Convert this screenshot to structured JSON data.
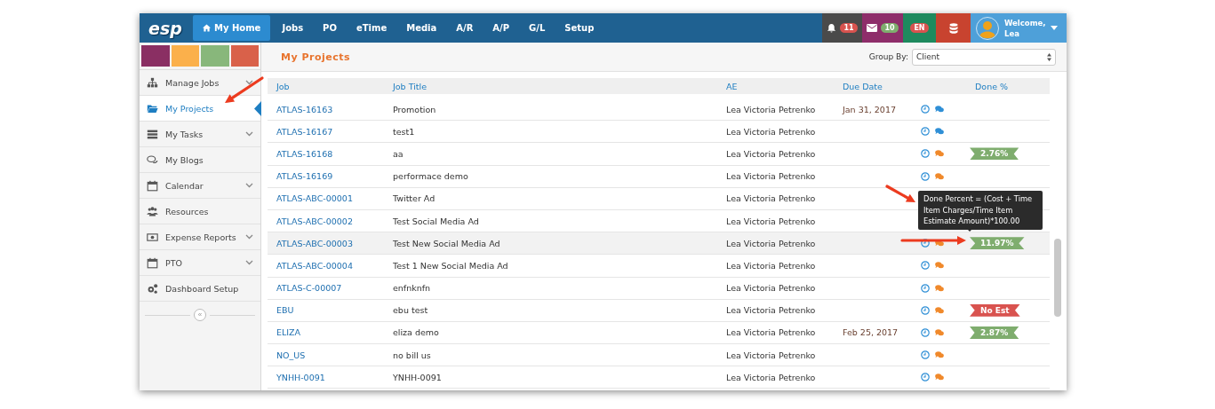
{
  "nav": {
    "logo": "esp",
    "items": [
      {
        "label": "My Home",
        "selected": true
      },
      {
        "label": "Jobs",
        "selected": false
      },
      {
        "label": "PO",
        "selected": false
      },
      {
        "label": "eTime",
        "selected": false
      },
      {
        "label": "Media",
        "selected": false
      },
      {
        "label": "A/R",
        "selected": false
      },
      {
        "label": "A/P",
        "selected": false
      },
      {
        "label": "G/L",
        "selected": false
      },
      {
        "label": "Setup",
        "selected": false
      }
    ],
    "notifications": "11",
    "messages": "10",
    "language": "EN",
    "welcome": "Welcome,",
    "user": "Lea"
  },
  "sidebar": {
    "swatches": [
      {
        "color": "#8a2f63"
      },
      {
        "color": "#fbb04b"
      },
      {
        "color": "#88b77b"
      },
      {
        "color": "#d9614a"
      }
    ],
    "items": [
      {
        "kind": "sitemap",
        "label": "Manage Jobs",
        "expandable": true,
        "selected": false
      },
      {
        "kind": "folder",
        "label": "My Projects",
        "expandable": false,
        "selected": true
      },
      {
        "kind": "tasks",
        "label": "My Tasks",
        "expandable": true,
        "selected": false
      },
      {
        "kind": "chat",
        "label": "My Blogs",
        "expandable": false,
        "selected": false
      },
      {
        "kind": "calendar",
        "label": "Calendar",
        "expandable": true,
        "selected": false
      },
      {
        "kind": "people",
        "label": "Resources",
        "expandable": false,
        "selected": false
      },
      {
        "kind": "money",
        "label": "Expense Reports",
        "expandable": true,
        "selected": false
      },
      {
        "kind": "calendar",
        "label": "PTO",
        "expandable": true,
        "selected": false
      },
      {
        "kind": "gears",
        "label": "Dashboard Setup",
        "expandable": false,
        "selected": false
      }
    ],
    "collapse": "«"
  },
  "page": {
    "title": "My Projects",
    "group_by_label": "Group By:",
    "group_by_value": "Client"
  },
  "table": {
    "columns": [
      "Job",
      "Job Title",
      "AE",
      "Due Date",
      "Done %"
    ],
    "rows": [
      {
        "job": "ATLAS-16163",
        "title": "Promotion",
        "ae": "Lea Victoria Petrenko",
        "due": "Jan 31, 2017",
        "chat": {
          "color": "#2f8fd6"
        },
        "highlighted": false
      },
      {
        "job": "ATLAS-16167",
        "title": "test1",
        "ae": "Lea Victoria Petrenko",
        "chat": {
          "color": "#2f8fd6"
        },
        "highlighted": false
      },
      {
        "job": "ATLAS-16168",
        "title": "aa",
        "ae": "Lea Victoria Petrenko",
        "chat": {
          "color": "#f0892b"
        },
        "highlighted": false,
        "done": {
          "text": "2.76%",
          "color": "#7fad6e"
        }
      },
      {
        "job": "ATLAS-16169",
        "title": "performace demo",
        "ae": "Lea Victoria Petrenko",
        "chat": {
          "color": "#f0892b"
        },
        "highlighted": false
      },
      {
        "job": "ATLAS-ABC-00001",
        "title": "Twitter Ad",
        "ae": "Lea Victoria Petrenko",
        "highlighted": false
      },
      {
        "job": "ATLAS-ABC-00002",
        "title": "Test Social Media Ad",
        "ae": "Lea Victoria Petrenko",
        "highlighted": false
      },
      {
        "job": "ATLAS-ABC-00003",
        "title": "Test New Social Media Ad",
        "ae": "Lea Victoria Petrenko",
        "chat": {
          "color": "#f0892b"
        },
        "highlighted": true,
        "done": {
          "text": "11.97%",
          "color": "#7fad6e"
        }
      },
      {
        "job": "ATLAS-ABC-00004",
        "title": "Test 1 New Social Media Ad",
        "ae": "Lea Victoria Petrenko",
        "chat": {
          "color": "#f0892b"
        },
        "highlighted": false
      },
      {
        "job": "ATLAS-C-00007",
        "title": "enfnknfn",
        "ae": "Lea Victoria Petrenko",
        "chat": {
          "color": "#f0892b"
        },
        "highlighted": false
      },
      {
        "job": "EBU",
        "title": "ebu test",
        "ae": "Lea Victoria Petrenko",
        "chat": {
          "color": "#f0892b"
        },
        "highlighted": false,
        "done": {
          "text": "No Est",
          "color": "#d9534f"
        }
      },
      {
        "job": "ELIZA",
        "title": "eliza demo",
        "ae": "Lea Victoria Petrenko",
        "due": "Feb 25, 2017",
        "chat": {
          "color": "#f0892b"
        },
        "highlighted": false,
        "done": {
          "text": "2.87%",
          "color": "#7fad6e"
        }
      },
      {
        "job": "NO_US",
        "title": "no bill us",
        "ae": "Lea Victoria Petrenko",
        "chat": {
          "color": "#f0892b"
        },
        "highlighted": false
      },
      {
        "job": "YNHH-0091",
        "title": "YNHH-0091",
        "ae": "Lea Victoria Petrenko",
        "chat": {
          "color": "#f0892b"
        },
        "highlighted": false
      }
    ]
  },
  "tooltip": "Done Percent = (Cost + Time Item Charges/Time Item Estimate Amount)*100.00"
}
